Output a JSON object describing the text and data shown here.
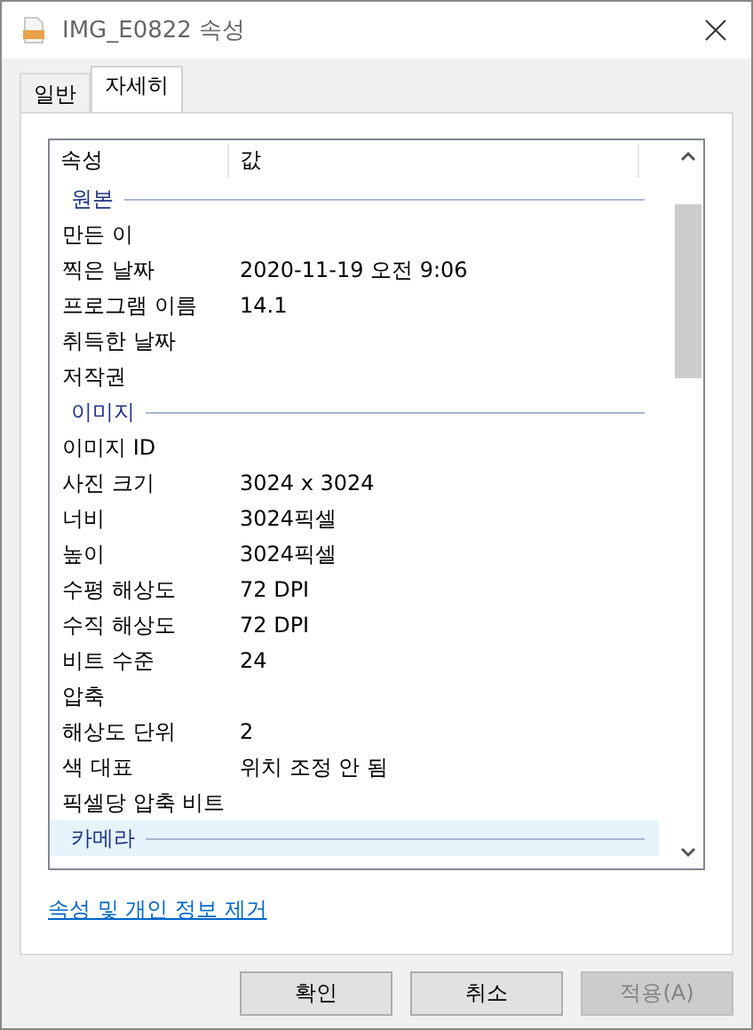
{
  "window": {
    "title": "IMG_E0822 속성"
  },
  "tabs": [
    {
      "label": "일반",
      "selected": false
    },
    {
      "label": "자세히",
      "selected": true
    }
  ],
  "table": {
    "columns": [
      "속성",
      "값"
    ],
    "rows": [
      {
        "kind": "section",
        "label": "원본",
        "selected": false
      },
      {
        "kind": "property",
        "name": "만든 이",
        "selected": false
      },
      {
        "kind": "property",
        "name": "찍은 날짜",
        "value": "2020-11-19 오전 9:06",
        "selected": false
      },
      {
        "kind": "property",
        "name": "프로그램 이름",
        "value": "14.1",
        "selected": false
      },
      {
        "kind": "property",
        "name": "취득한 날짜",
        "selected": false
      },
      {
        "kind": "property",
        "name": "저작권",
        "selected": false
      },
      {
        "kind": "section",
        "label": "이미지",
        "selected": false
      },
      {
        "kind": "property",
        "name": "이미지 ID",
        "selected": false
      },
      {
        "kind": "property",
        "name": "사진 크기",
        "value": "3024 x 3024",
        "selected": false
      },
      {
        "kind": "property",
        "name": "너비",
        "value": "3024픽셀",
        "selected": false
      },
      {
        "kind": "property",
        "name": "높이",
        "value": "3024픽셀",
        "selected": false
      },
      {
        "kind": "property",
        "name": "수평 해상도",
        "value": "72 DPI",
        "selected": false
      },
      {
        "kind": "property",
        "name": "수직 해상도",
        "value": "72 DPI",
        "selected": false
      },
      {
        "kind": "property",
        "name": "비트 수준",
        "value": "24",
        "selected": false
      },
      {
        "kind": "property",
        "name": "압축",
        "selected": false
      },
      {
        "kind": "property",
        "name": "해상도 단위",
        "value": "2",
        "selected": false
      },
      {
        "kind": "property",
        "name": "색 대표",
        "value": "위치 조정 안 됨",
        "selected": false
      },
      {
        "kind": "property",
        "name": "픽셀당 압축 비트",
        "selected": false
      },
      {
        "kind": "section",
        "label": "카메라",
        "selected": true
      }
    ]
  },
  "link": "속성 및 개인 정보 제거",
  "buttons": [
    {
      "label": "확인",
      "disabled": false
    },
    {
      "label": "취소",
      "disabled": false
    },
    {
      "label": "적용(A)",
      "disabled": true
    }
  ]
}
